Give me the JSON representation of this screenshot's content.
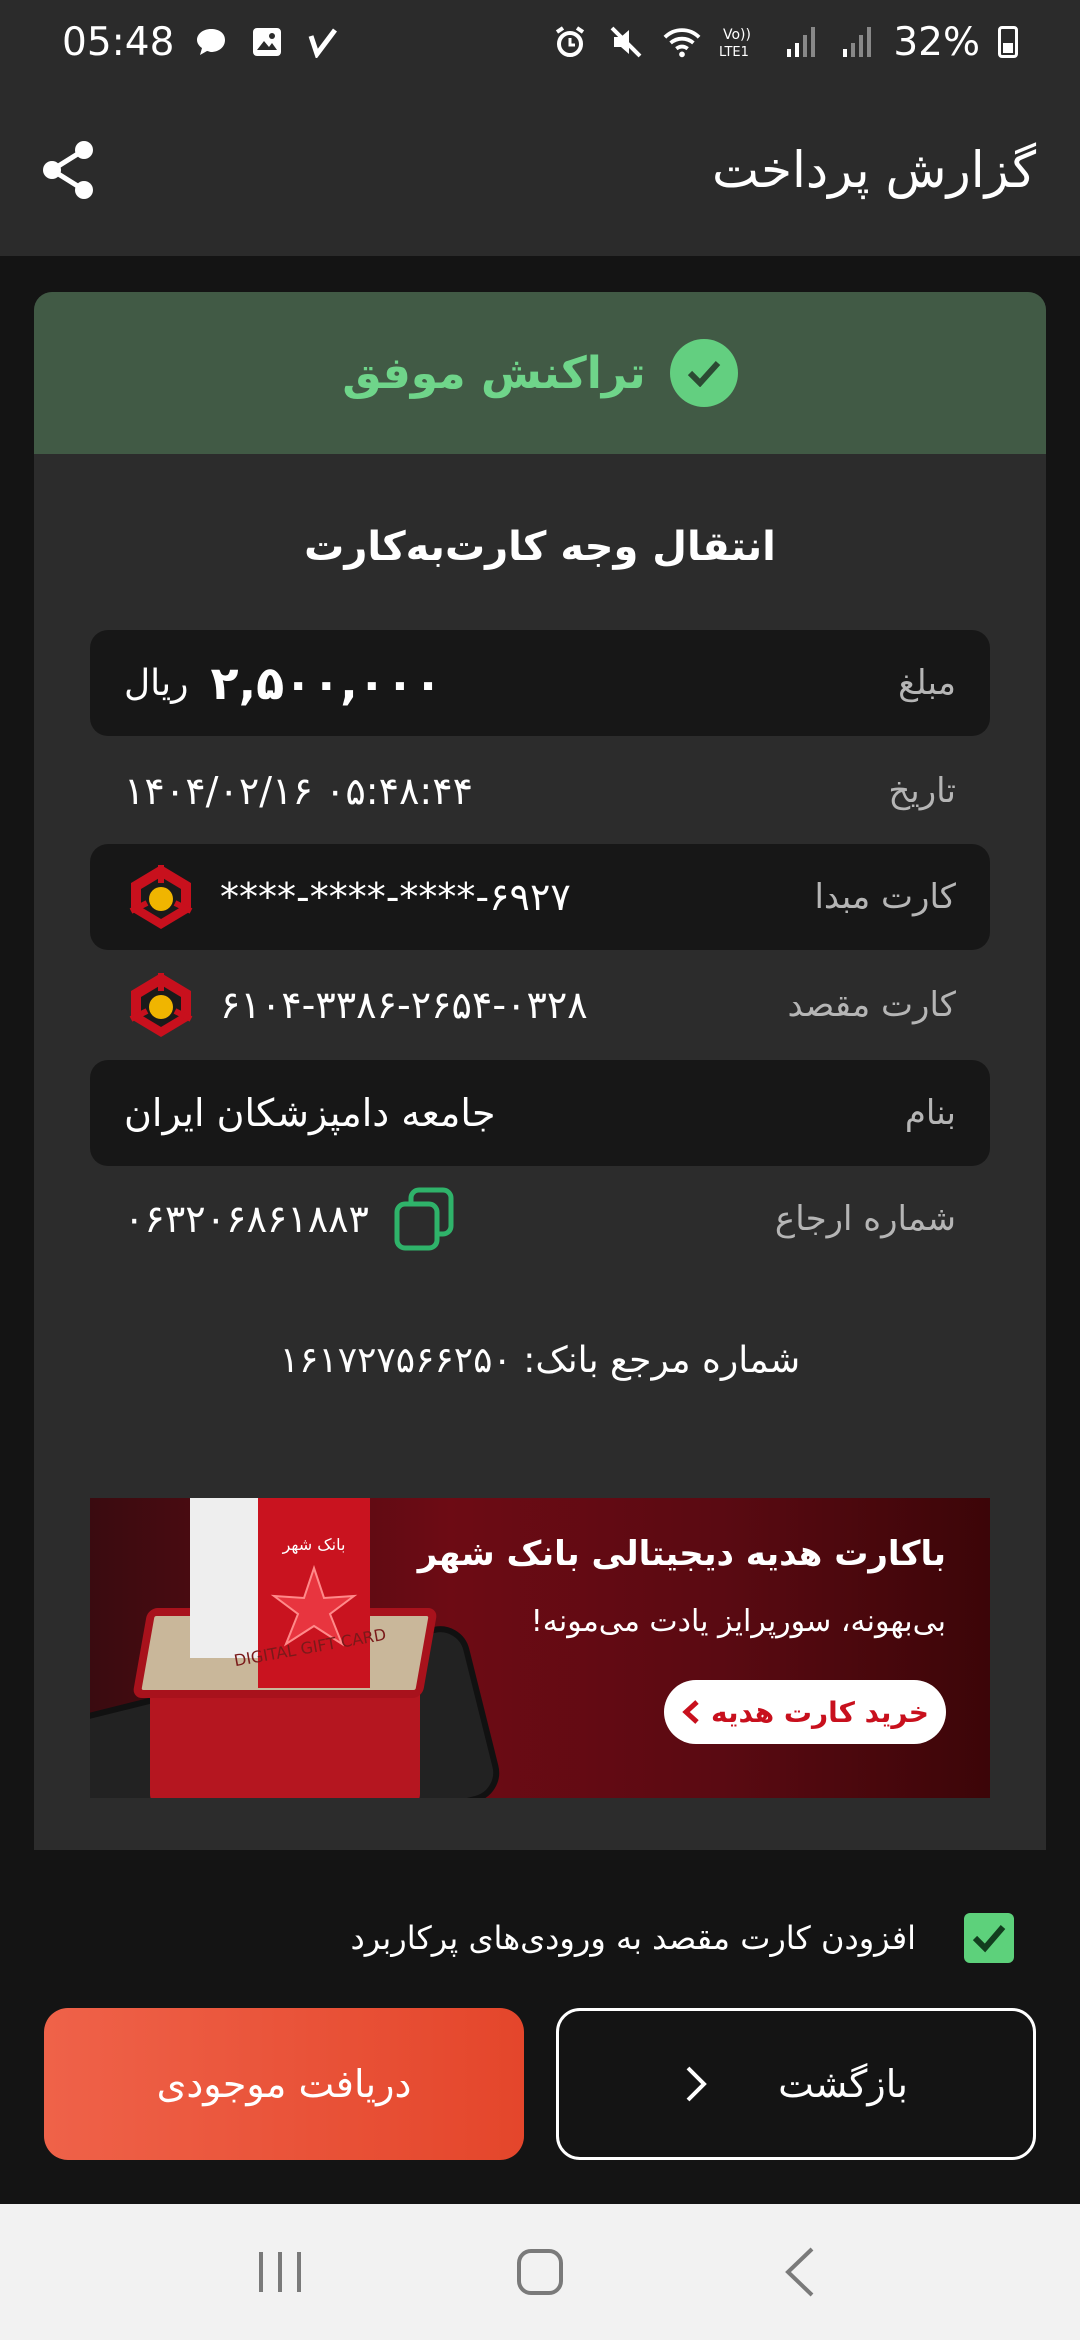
{
  "status_bar": {
    "time": "05:48",
    "battery": "32%"
  },
  "header": {
    "title": "گزارش پرداخت",
    "share_icon": "share-icon"
  },
  "receipt": {
    "status_text": "تراکنش موفق",
    "transaction_type": "انتقال وجه کارت‌به‌کارت",
    "amount": {
      "label": "مبلغ",
      "value": "۲,۵۰۰,۰۰۰",
      "unit": "ریال"
    },
    "date": {
      "label": "تاریخ",
      "value": "۱۴۰۴/۰۲/۱۶ ۰۵:۴۸:۴۴"
    },
    "source_card": {
      "label": "کارت مبدا",
      "value": "****-****-****-۶۹۲۷"
    },
    "dest_card": {
      "label": "کارت مقصد",
      "value": "۶۱۰۴-۳۳۸۶-۲۶۵۴-۰۳۲۸"
    },
    "name": {
      "label": "بنام",
      "value": "جامعه دامپزشکان ایران"
    },
    "reference": {
      "label": "شماره ارجاع",
      "value": "۰۶۳۲۰۶۸۶۱۸۸۳"
    },
    "bank_reference": "شماره مرجع بانک: ۱۶۱۷۲۷۵۶۶۲۵۰"
  },
  "ad": {
    "title": "باکارت هدیه دیجیتالی بانک شهر",
    "subtitle": "بی‌بهونه، سورپرایز یادت می‌مونه!",
    "button": "خرید کارت هدیه",
    "card_label": "DIGITAL GIFT CARD",
    "brand": "بانک شهر"
  },
  "favorite": {
    "label": "افزودن کارت مقصد به ورودی‌های پرکاربرد",
    "checked": true
  },
  "actions": {
    "balance": "دریافت موجودی",
    "back": "بازگشت"
  },
  "colors": {
    "success_bg": "#415a45",
    "success_text": "#6fd58a",
    "primary_button": "#e8502f",
    "bank_red": "#c8101d"
  }
}
